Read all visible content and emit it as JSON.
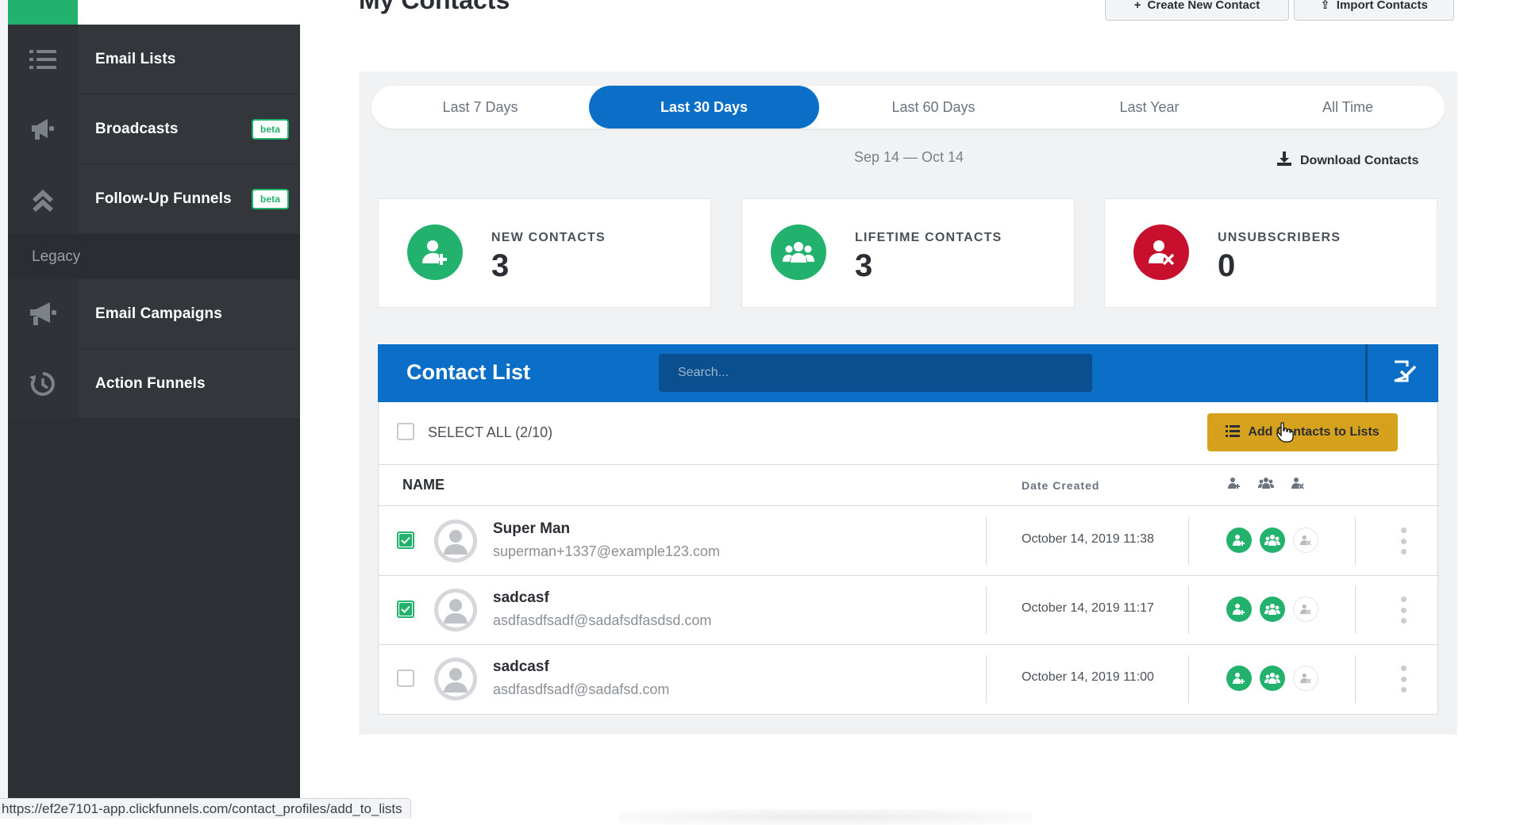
{
  "sidebar": {
    "items": [
      {
        "label": "Email Lists",
        "icon": "list-icon",
        "badge": ""
      },
      {
        "label": "Broadcasts",
        "icon": "megaphone-icon",
        "badge": "beta"
      },
      {
        "label": "Follow-Up Funnels",
        "icon": "chevrons-up-icon",
        "badge": "beta"
      },
      {
        "label": "Email Campaigns",
        "icon": "megaphone-icon",
        "badge": ""
      },
      {
        "label": "Action Funnels",
        "icon": "history-icon",
        "badge": ""
      }
    ],
    "section_legacy": "Legacy"
  },
  "header": {
    "title": "My Contacts",
    "create_btn": "Create New Contact",
    "import_btn": "Import Contacts"
  },
  "range_tabs": [
    "Last 7 Days",
    "Last 30 Days",
    "Last 60 Days",
    "Last Year",
    "All Time"
  ],
  "active_range": "Last 30 Days",
  "date_range": "Sep 14 — Oct 14",
  "download": "Download Contacts",
  "stats": [
    {
      "label": "NEW CONTACTS",
      "value": "3",
      "color": "#23b26d",
      "icon": "user-plus-icon"
    },
    {
      "label": "LIFETIME CONTACTS",
      "value": "3",
      "color": "#23b26d",
      "icon": "users-icon"
    },
    {
      "label": "UNSUBSCRIBERS",
      "value": "0",
      "color": "#c8102e",
      "icon": "user-x-icon"
    }
  ],
  "contact_list": {
    "title": "Contact List",
    "search_placeholder": "Search...",
    "select_all": "SELECT ALL (2/10)",
    "add_to_lists": "Add Contacts to Lists",
    "col_name": "NAME",
    "col_date": "Date Created",
    "rows": [
      {
        "name": "Super Man",
        "email": "superman+1337@example123.com",
        "date": "October 14, 2019 11:38",
        "checked": true
      },
      {
        "name": "sadcasf",
        "email": "asdfasdfsadf@sadafsdfasdsd.com",
        "date": "October 14, 2019 11:17",
        "checked": true
      },
      {
        "name": "sadcasf",
        "email": "asdfasdfsadf@sadafsd.com",
        "date": "October 14, 2019 11:00",
        "checked": false
      }
    ]
  },
  "status_url": "https://ef2e7101-app.clickfunnels.com/contact_profiles/add_to_lists",
  "colors": {
    "brand_blue": "#0b6fc7",
    "green": "#23b26d",
    "red": "#c8102e",
    "gold": "#d6a11c",
    "sidebar": "#2c3035"
  }
}
